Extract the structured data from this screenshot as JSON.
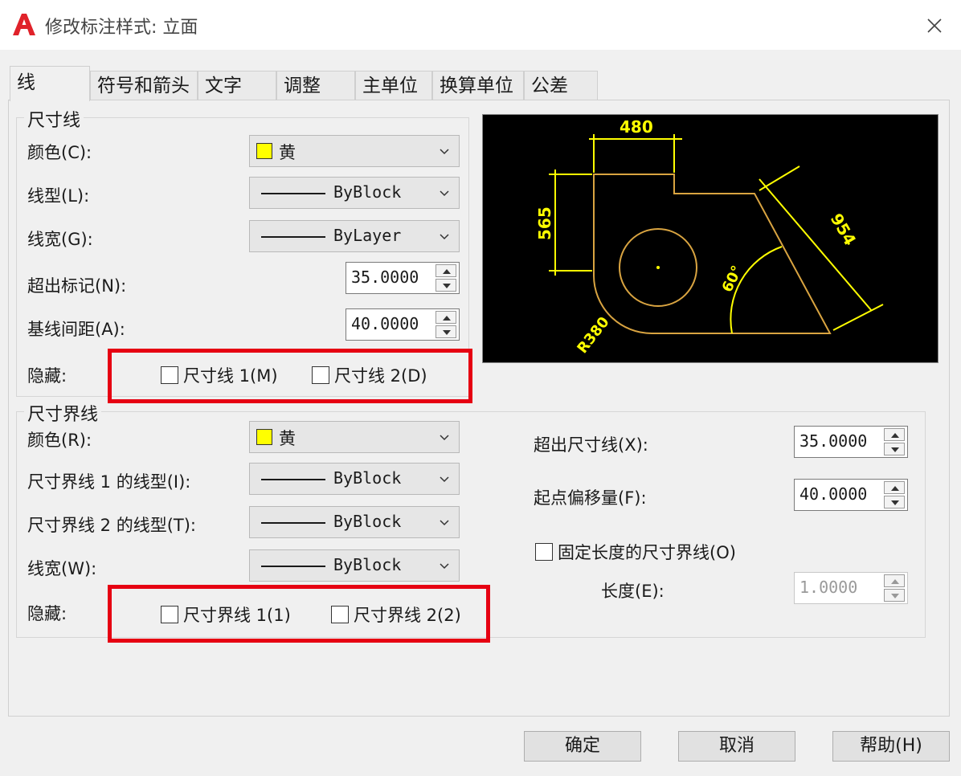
{
  "window": {
    "title": "修改标注样式: 立面",
    "close_icon": "close-icon"
  },
  "tabs": [
    "线",
    "符号和箭头",
    "文字",
    "调整",
    "主单位",
    "换算单位",
    "公差"
  ],
  "dim_line": {
    "group_title": "尺寸线",
    "color_label": "颜色(C):",
    "color_value": "黄",
    "linetype_label": "线型(L):",
    "linetype_value": "ByBlock",
    "lineweight_label": "线宽(G):",
    "lineweight_value": "ByLayer",
    "extend_ticks_label": "超出标记(N):",
    "extend_ticks_value": "35.0000",
    "baseline_label": "基线间距(A):",
    "baseline_value": "40.0000",
    "suppress_label": "隐藏:",
    "suppress1": "尺寸线 1(M)",
    "suppress2": "尺寸线 2(D)"
  },
  "ext_line": {
    "group_title": "尺寸界线",
    "color_label": "颜色(R):",
    "color_value": "黄",
    "lt1_label": "尺寸界线 1 的线型(I):",
    "lt1_value": "ByBlock",
    "lt2_label": "尺寸界线 2 的线型(T):",
    "lt2_value": "ByBlock",
    "lineweight_label": "线宽(W):",
    "lineweight_value": "ByBlock",
    "suppress_label": "隐藏:",
    "suppress1": "尺寸界线 1(1)",
    "suppress2": "尺寸界线 2(2)",
    "extend_label": "超出尺寸线(X):",
    "extend_value": "35.0000",
    "offset_label": "起点偏移量(F):",
    "offset_value": "40.0000",
    "fixed_label": "固定长度的尺寸界线(O)",
    "length_label": "长度(E):",
    "length_value": "1.0000"
  },
  "preview": {
    "dim_480": "480",
    "dim_565": "565",
    "dim_954": "954",
    "dim_60": "60°",
    "dim_r380": "R380"
  },
  "colors": {
    "dim_color": "#ffff00",
    "geom_color": "#d9a441",
    "highlight": "#e60012"
  },
  "buttons": {
    "ok": "确定",
    "cancel": "取消",
    "help": "帮助(H)"
  }
}
